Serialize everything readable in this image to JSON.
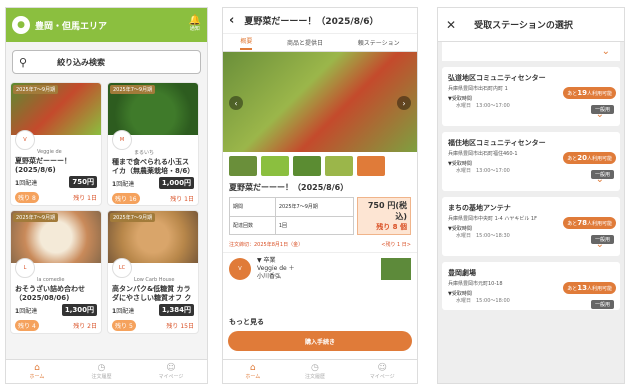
{
  "s1": {
    "title": "豊岡・但馬エリア",
    "notif": "通知",
    "filter": "絞り込み検索",
    "cards": [
      {
        "period": "2025年7〜9月期",
        "shop": "Veggie de",
        "title": "夏野菜だーーー！(2025/8/6)",
        "count": "1",
        "count_label": "回配達",
        "price": "750",
        "price_unit": "円",
        "bought": "残り",
        "bought_n": "8",
        "remain": "残り",
        "remain_n": "1",
        "remain_unit": "日",
        "color": "#5b8c32"
      },
      {
        "period": "2025年7〜9月期",
        "shop": "まるいち",
        "title": "種まで食べられる小玉スイカ（無農薬栽培・8/6）",
        "count": "1",
        "count_label": "回配達",
        "price": "1,000",
        "price_unit": "円",
        "bought": "残り",
        "bought_n": "16",
        "remain": "残り",
        "remain_n": "1",
        "remain_unit": "日",
        "color": "#3f7a2a"
      },
      {
        "period": "2025年7〜9月期",
        "shop": "la comedie",
        "title": "おそうざい詰め合わせ（2025/08/06)",
        "count": "1",
        "count_label": "回配達",
        "price": "1,300",
        "price_unit": "円",
        "bought": "残り",
        "bought_n": "4",
        "remain": "残り",
        "remain_n": "2",
        "remain_unit": "日",
        "color": "#c98a5a"
      },
      {
        "period": "2025年7〜9月期",
        "shop": "Low Carb House",
        "title": "高タンパク&低糖質 カラダにやさしい糖質オフ クッ…",
        "count": "1",
        "count_label": "回配達",
        "price": "1,384",
        "price_unit": "円",
        "bought": "残り",
        "bought_n": "5",
        "remain": "残り",
        "remain_n": "15",
        "remain_unit": "日",
        "color": "#b8874a"
      }
    ],
    "tabs": [
      "ホーム",
      "注文履歴",
      "マイページ"
    ]
  },
  "s2": {
    "title": "夏野菜だーーー！（2025/8/6）",
    "tabs": [
      "概要",
      "商品と提供日",
      "頼ステーション"
    ],
    "item_title": "夏野菜だーーー！（2025/8/6）",
    "rows": [
      [
        "期間",
        "2025年7〜9月期"
      ],
      [
        "配達回数",
        "1回"
      ]
    ],
    "price": "750 円(税込)",
    "remain": "残り 8 個",
    "deadline": "注文締切：2025年8月1日（金）",
    "deadline_right": "<残り 1 日>",
    "shop_line1": "▼ 卒業",
    "shop_name": "Veggie de ＋",
    "shop_person": "小川香弘",
    "more": "もっと見る",
    "buy": "購入手続き",
    "tabs_bottom": [
      "ホーム",
      "注文履歴",
      "マイページ"
    ]
  },
  "s3": {
    "title": "受取ステーションの選択",
    "stations": [
      {
        "name": "弘道地区コミュニティセンター",
        "addr": "兵庫県豊岡市出石町内町 1",
        "avail_pre": "あと",
        "avail_n": "19",
        "avail_post": "人利用可能",
        "rcv": "▼受取時間",
        "day": "水曜日　13:00〜17:00",
        "gen": "一般用"
      },
      {
        "name": "福住地区コミュニティセンター",
        "addr": "兵庫県豊岡市出石町福住460-1",
        "avail_pre": "あと",
        "avail_n": "20",
        "avail_post": "人利用可能",
        "rcv": "▼受取時間",
        "day": "水曜日　13:00〜17:00",
        "gen": "一般用"
      },
      {
        "name": "まちの基地アンテナ",
        "addr": "兵庫県豊岡市中央町 1-4 ハヤキビル 1F",
        "avail_pre": "あと",
        "avail_n": "78",
        "avail_post": "人利用可能",
        "rcv": "▼受取時間",
        "day": "水曜日　15:00〜18:30",
        "gen": "一般用"
      },
      {
        "name": "豊岡劇場",
        "addr": "兵庫県豊岡市元町10-18",
        "avail_pre": "あと",
        "avail_n": "13",
        "avail_post": "人利用可能",
        "rcv": "▼受取時間",
        "day": "水曜日　15:00〜18:00",
        "gen": "一般用"
      }
    ]
  }
}
